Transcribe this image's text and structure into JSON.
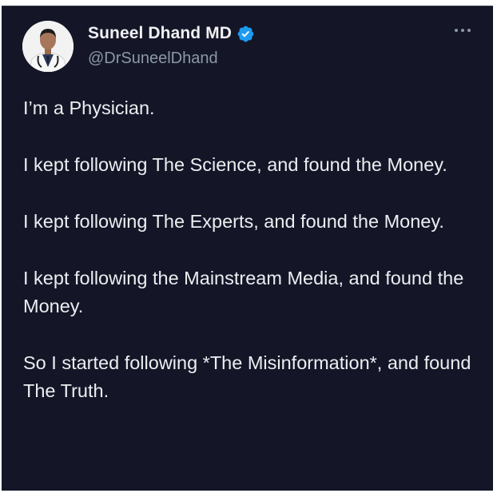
{
  "author": {
    "display_name": "Suneel Dhand MD",
    "handle": "@DrSuneelDhand",
    "verified": true
  },
  "menu": {
    "icon": "more-horizontal-icon"
  },
  "colors": {
    "background": "#141628",
    "text": "#eceef0",
    "secondary_text": "#8b98a5",
    "verified_badge": "#1d9bf0"
  },
  "post": {
    "paragraphs": [
      "I’m a Physician.",
      "I kept following The Science, and found the Money.",
      "I kept following The Experts, and found the Money.",
      "I kept following the Mainstream Media, and found the Money.",
      "So I started following *The Misinformation*, and found The Truth."
    ]
  }
}
